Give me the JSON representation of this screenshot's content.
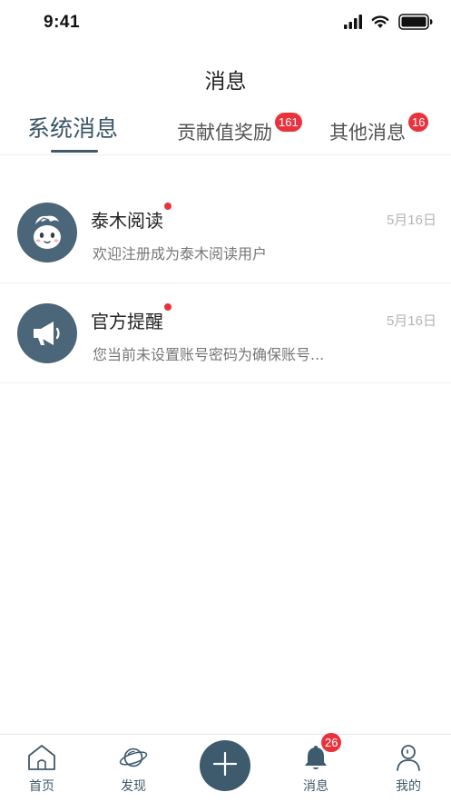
{
  "status_bar": {
    "time": "9:41",
    "icons": [
      "signal-icon",
      "wifi-icon",
      "battery-icon"
    ]
  },
  "header": {
    "title": "消息"
  },
  "tabs": [
    {
      "label": "系统消息",
      "badge": "",
      "active": true
    },
    {
      "label": "贡献值奖励",
      "badge": "161",
      "active": false
    },
    {
      "label": "其他消息",
      "badge": "16",
      "active": false
    }
  ],
  "messages": [
    {
      "title": "泰木阅读",
      "date": "5月16日",
      "preview": "欢迎注册成为泰木阅读用户",
      "unread": true,
      "icon": "mascot-icon"
    },
    {
      "title": "官方提醒",
      "date": "5月16日",
      "preview": "您当前未设置账号密码为确保账号...",
      "unread": true,
      "icon": "megaphone-icon"
    }
  ],
  "tab_bar": {
    "items": [
      {
        "label": "首页",
        "icon": "home-icon"
      },
      {
        "label": "发现",
        "icon": "planet-icon"
      },
      {
        "label": "",
        "icon": "plus-icon"
      },
      {
        "label": "消息",
        "icon": "bell-icon",
        "badge": "26"
      },
      {
        "label": "我的",
        "icon": "user-icon"
      }
    ]
  },
  "colors": {
    "accent": "#3e5a6d",
    "badge": "#e8333d",
    "date": "#b5b5b5"
  }
}
